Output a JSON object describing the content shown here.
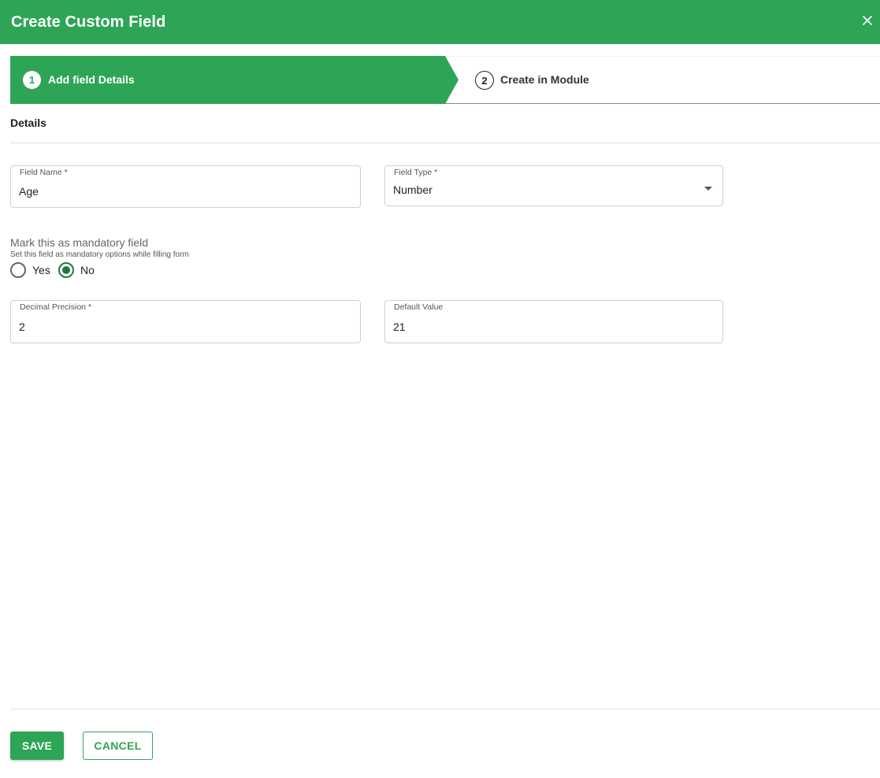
{
  "dialog": {
    "title": "Create Custom Field",
    "close_icon": "close-icon"
  },
  "stepper": {
    "steps": [
      {
        "number": "1",
        "label": "Add field Details",
        "active": true
      },
      {
        "number": "2",
        "label": "Create in Module",
        "active": false
      }
    ]
  },
  "section": {
    "title": "Details"
  },
  "fields": {
    "field_name": {
      "label": "Field Name *",
      "value": "Age"
    },
    "field_type": {
      "label": "Field Type *",
      "value": "Number"
    },
    "decimal_precision": {
      "label": "Decimal Precision *",
      "value": "2"
    },
    "default_value": {
      "label": "Default Value",
      "value": "21"
    }
  },
  "mandatory": {
    "title": "Mark this as mandatory field",
    "subtitle": "Set this field as mandatory options while filling form",
    "options": [
      {
        "label": "Yes",
        "checked": false
      },
      {
        "label": "No",
        "checked": true
      }
    ]
  },
  "footer": {
    "save_label": "SAVE",
    "cancel_label": "CANCEL"
  },
  "colors": {
    "primary": "#2ea556",
    "radio_checked": "#1f7a40"
  }
}
